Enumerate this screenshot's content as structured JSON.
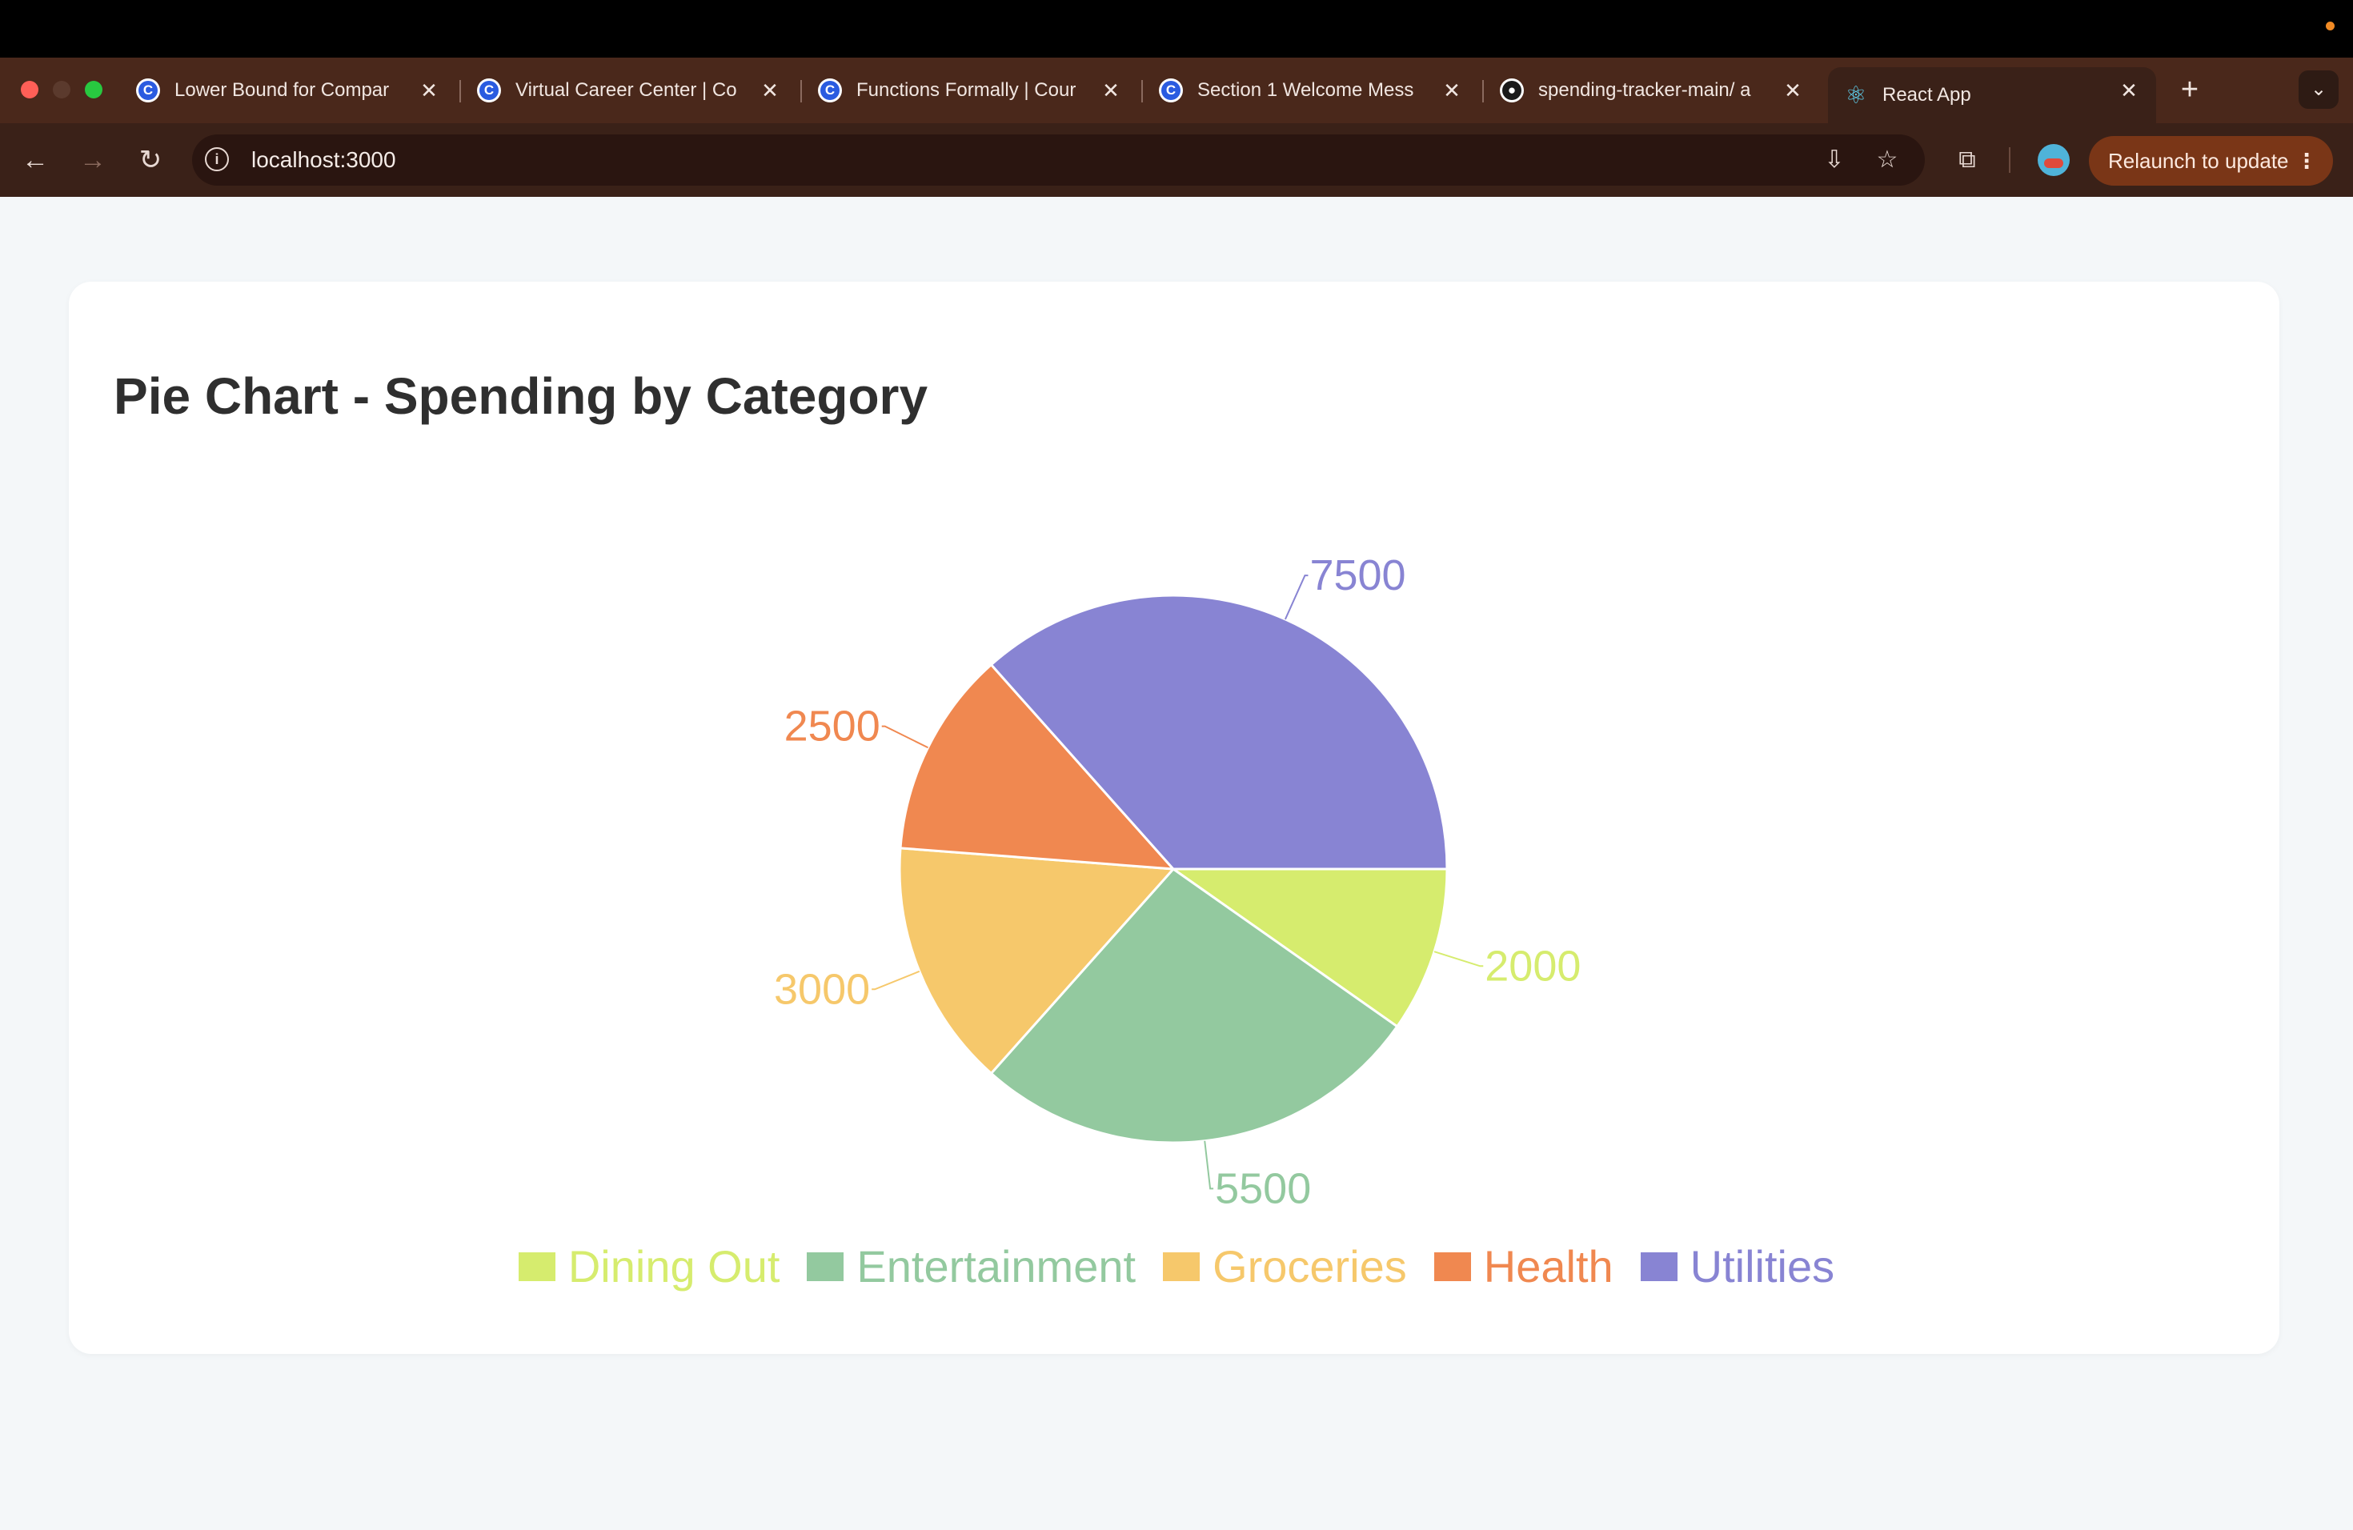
{
  "browser": {
    "tabs": [
      {
        "label": "Lower Bound for Compar",
        "icon": "coursera-icon",
        "active": false
      },
      {
        "label": "Virtual Career Center | Co",
        "icon": "coursera-icon",
        "active": false
      },
      {
        "label": "Functions Formally | Cour",
        "icon": "coursera-icon",
        "active": false
      },
      {
        "label": "Section 1 Welcome Mess",
        "icon": "coursera-icon",
        "active": false
      },
      {
        "label": "spending-tracker-main/ a",
        "icon": "github-icon",
        "active": false
      },
      {
        "label": "React App",
        "icon": "react-icon",
        "active": true
      }
    ],
    "url": "localhost:3000",
    "relaunch_label": "Relaunch to update"
  },
  "page": {
    "title": "Pie Chart - Spending by Category"
  },
  "chart_data": {
    "type": "pie",
    "title": "Pie Chart - Spending by Category",
    "categories": [
      "Dining Out",
      "Entertainment",
      "Groceries",
      "Health",
      "Utilities"
    ],
    "values": [
      2000,
      5500,
      3000,
      2500,
      7500
    ],
    "colors": [
      "#d6ec6e",
      "#93c99f",
      "#f6c86b",
      "#f08850",
      "#8884d3"
    ],
    "legend_position": "bottom",
    "slice_labels": [
      "2000",
      "5500",
      "3000",
      "2500",
      "7500"
    ]
  }
}
